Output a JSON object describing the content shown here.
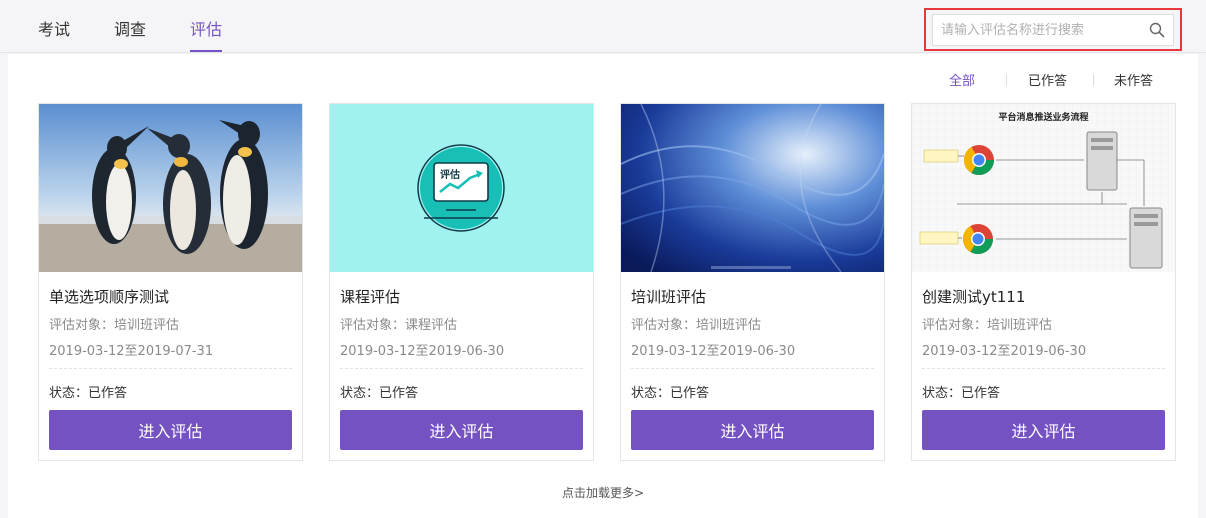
{
  "tabs": [
    {
      "label": "考试",
      "active": false
    },
    {
      "label": "调查",
      "active": false
    },
    {
      "label": "评估",
      "active": true
    }
  ],
  "search": {
    "placeholder": "请输入评估名称进行搜索",
    "value": "",
    "icon": "search-icon"
  },
  "filters": [
    {
      "label": "全部",
      "active": true
    },
    {
      "label": "已作答",
      "active": false
    },
    {
      "label": "未作答",
      "active": false
    }
  ],
  "cards": [
    {
      "image": "penguins",
      "title": "单选选项顺序测试",
      "target": "评估对象：培训班评估",
      "dates": "2019-03-12至2019-07-31",
      "status": "状态：已作答",
      "button": "进入评估"
    },
    {
      "image": "evaluation-chart",
      "image_label": "评估",
      "title": "课程评估",
      "target": "评估对象：课程评估",
      "dates": "2019-03-12至2019-06-30",
      "status": "状态：已作答",
      "button": "进入评估"
    },
    {
      "image": "blue-abstract",
      "title": "培训班评估",
      "target": "评估对象：培训班评估",
      "dates": "2019-03-12至2019-06-30",
      "status": "状态：已作答",
      "button": "进入评估"
    },
    {
      "image": "flowchart",
      "image_label": "平台消息推送业务流程",
      "title": "创建测试yt111",
      "target": "评估对象：培训班评估",
      "dates": "2019-03-12至2019-06-30",
      "status": "状态：已作答",
      "button": "进入评估"
    }
  ],
  "load_more": "点击加载更多>",
  "colors": {
    "accent": "#7552c2",
    "search_highlight": "#e8383d",
    "page_bg": "#f5f5f7"
  }
}
